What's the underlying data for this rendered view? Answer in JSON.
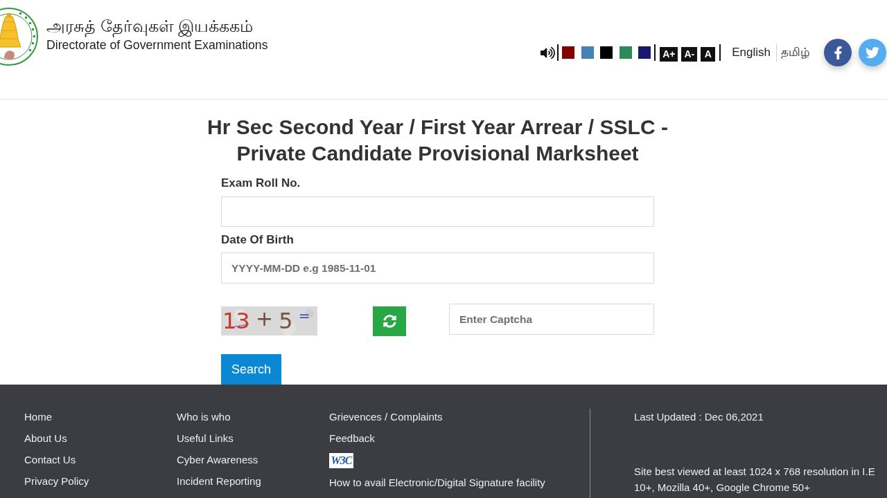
{
  "header": {
    "title": "அரசுத் தேர்வுகள் இயக்ககம்",
    "subtitle": "Directorate of Government Examinations"
  },
  "toolbar": {
    "theme_colors": [
      {
        "color": "#800000"
      },
      {
        "color": "#4682b4"
      },
      {
        "color": "#000000"
      },
      {
        "color": "#2e8b57"
      },
      {
        "color": "#191970"
      }
    ],
    "font_sizes": [
      "A+",
      "A-",
      "A"
    ],
    "languages": [
      "English",
      "தமிழ்"
    ]
  },
  "form": {
    "title": "Hr Sec Second Year / First Year Arrear / SSLC - Private Candidate Provisional Marksheet",
    "fields": [
      {
        "label": "Exam Roll No."
      },
      {
        "label": "Date Of Birth",
        "placeholder": "YYYY-MM-DD e.g 1985-11-01"
      }
    ],
    "captcha": {
      "question": "13 + 5 $^{=}$",
      "placeholder": "Enter Captcha"
    },
    "submit": "Search"
  },
  "footer": {
    "columns": [
      {
        "links": [
          {
            "kind": "link",
            "label": "Home"
          },
          {
            "kind": "link",
            "label": "About Us"
          },
          {
            "kind": "link",
            "label": "Contact Us"
          },
          {
            "kind": "link",
            "label": "Privacy Policy"
          }
        ]
      },
      {
        "links": [
          {
            "kind": "link",
            "label": "Who is who"
          },
          {
            "kind": "link",
            "label": "Useful Links"
          },
          {
            "kind": "link",
            "label": "Cyber Awareness"
          },
          {
            "kind": "link",
            "label": "Incident Reporting"
          }
        ]
      },
      {
        "links": [
          {
            "kind": "link",
            "label": "Grievences / Complaints"
          },
          {
            "kind": "link",
            "label": "Feedback"
          },
          {
            "kind": "badge",
            "label": "W3C"
          },
          {
            "kind": "link",
            "label": "How to avail Electronic/Digital Signature facility"
          }
        ]
      }
    ],
    "last_updated": "Last Updated : Dec 06,2021",
    "browser_note": "Site best viewed at least 1024 x 768 resolution in I.E 10+, Mozilla 40+, Google Chrome 50+"
  }
}
